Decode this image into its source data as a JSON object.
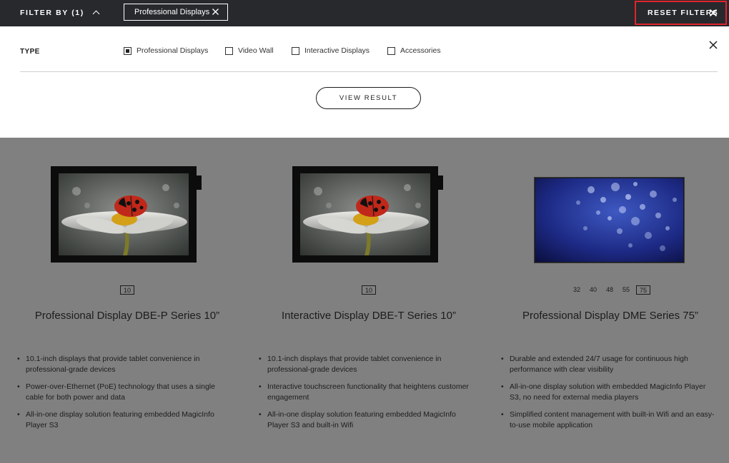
{
  "topbar": {
    "filter_by": "FILTER BY (1)",
    "active_chip": "Professional Displays",
    "reset": "RESET FILTERS"
  },
  "panel": {
    "type_label": "TYPE",
    "options": [
      {
        "label": "Professional Displays",
        "checked": true
      },
      {
        "label": "Video Wall",
        "checked": false
      },
      {
        "label": "Interactive Displays",
        "checked": false
      },
      {
        "label": "Accessories",
        "checked": false
      }
    ],
    "view_result": "VIEW RESULT"
  },
  "products": [
    {
      "name": "Professional Display DBE-P Series 10”",
      "sizes": [
        "10"
      ],
      "selected_size": "10",
      "features": [
        "10.1-inch displays that provide tablet convenience in professional-grade devices",
        "Power-over-Ethernet (PoE) technology that uses a single cable for both power and data",
        "All-in-one display solution featuring embedded MagicInfo Player S3"
      ]
    },
    {
      "name": "Interactive Display DBE-T Series 10”",
      "sizes": [
        "10"
      ],
      "selected_size": "10",
      "features": [
        "10.1-inch displays that provide tablet convenience in professional-grade devices",
        "Interactive touchscreen functionality that heightens customer engagement",
        "All-in-one display solution featuring embedded MagicInfo Player S3 and built-in Wifi"
      ]
    },
    {
      "name": "Professional Display DME Series 75”",
      "sizes": [
        "32",
        "40",
        "48",
        "55",
        "75"
      ],
      "selected_size": "75",
      "features": [
        "Durable and extended 24/7 usage for continuous high performance with clear visibility",
        "All-in-one display solution with embedded MagicInfo Player S3, no need for external media players",
        "Simplified content management with built-in Wifi and an easy-to-use mobile application"
      ]
    }
  ]
}
